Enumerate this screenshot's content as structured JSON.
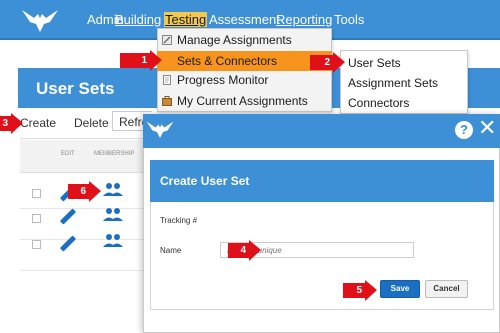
{
  "nav": {
    "items": [
      "Admin",
      "Building",
      "Testing",
      "Assessment",
      "Reporting",
      "Tools"
    ],
    "active": "Testing"
  },
  "testing_menu": {
    "items": [
      "Manage Assignments",
      "Sets & Connectors",
      "Progress Monitor",
      "My Current Assignments"
    ],
    "highlighted": "Sets & Connectors"
  },
  "sub_menu": {
    "items": [
      "User Sets",
      "Assignment Sets",
      "Connectors"
    ]
  },
  "user_sets_page": {
    "title": "User Sets",
    "toolbar": [
      "Create",
      "Delete",
      "Refresh"
    ],
    "columns": [
      "EDIT",
      "MEMBERSHIP"
    ],
    "row_count": 3
  },
  "modal": {
    "help": "?",
    "close": "✕",
    "form_title": "Create User Set",
    "tracking_label": "Tracking #",
    "name_label": "Name",
    "name_placeholder": "Must be unique",
    "save_label": "Save",
    "cancel_label": "Cancel"
  },
  "callouts": [
    "1",
    "2",
    "3",
    "4",
    "5",
    "6"
  ],
  "colors": {
    "brand_blue": "#3d8fd6",
    "menu_highlight": "#f7941d",
    "callout_red": "#e0101a",
    "save_blue": "#1b6fc2"
  }
}
